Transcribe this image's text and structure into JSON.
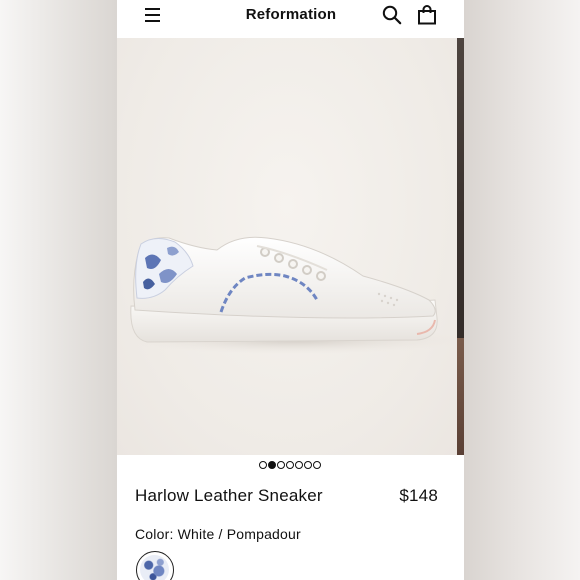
{
  "header": {
    "brand": "Reformation",
    "menu_icon": "hamburger-menu-icon",
    "search_icon": "search-icon",
    "bag_icon": "shopping-bag-icon"
  },
  "gallery": {
    "image_count": 7,
    "active_index": 1
  },
  "product": {
    "name": "Harlow Leather Sneaker",
    "price": "$148",
    "color_label": "Color:",
    "color_value": "White / Pompadour"
  },
  "colors": {
    "accent": "#111111",
    "background": "#ffffff",
    "pattern_blue": "#4c66a8"
  }
}
